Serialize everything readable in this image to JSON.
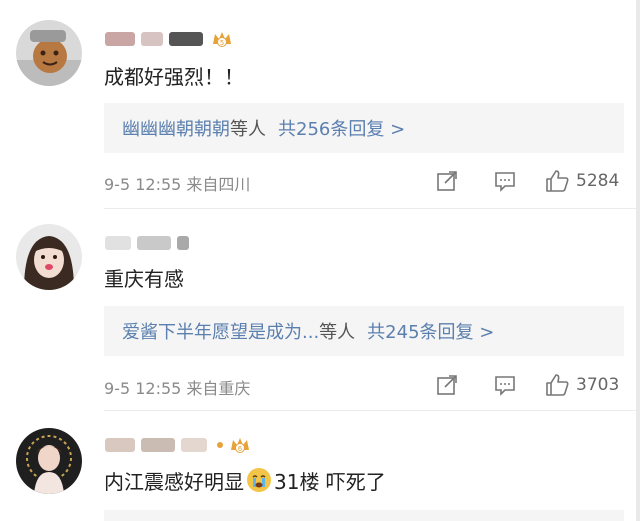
{
  "comments": [
    {
      "text": "成都好强烈！！",
      "replies": {
        "names": "幽幽幽朝朝朝",
        "suffix": "等人",
        "count": "共256条回复 >"
      },
      "meta": "9-5 12:55 来自四川",
      "likes": "5284",
      "badge": "5"
    },
    {
      "text": "重庆有感",
      "replies": {
        "names": "爱酱下半年愿望是成为...",
        "suffix": "等人",
        "count": "共245条回复 >"
      },
      "meta": "9-5 12:55 来自重庆",
      "likes": "3703"
    },
    {
      "text_before": "内江震感好明显",
      "text_after": "31楼 吓死了",
      "badge": "6"
    }
  ],
  "icons": {
    "share": "share-icon",
    "comment": "comment-icon",
    "like": "thumbs-up-icon",
    "vip": "crown-badge-icon",
    "crying": "crying-emoji-icon"
  },
  "colors": {
    "link": "#5b7fae",
    "reply_bg": "#f5f5f5",
    "meta": "#8a8a8a",
    "crown": "#e8a23a"
  }
}
